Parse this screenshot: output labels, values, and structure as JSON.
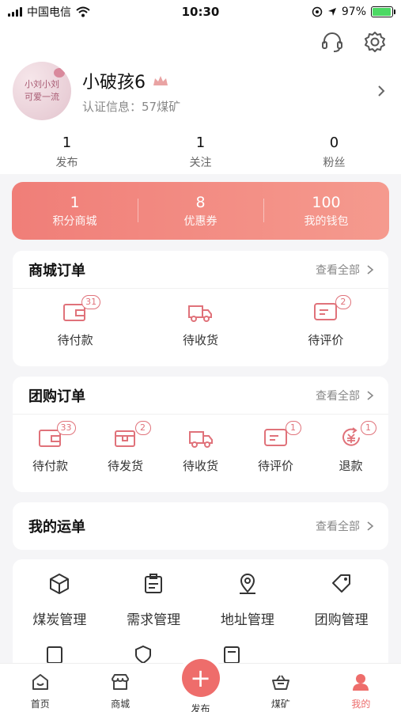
{
  "status_bar": {
    "carrier": "中国电信",
    "time": "10:30",
    "battery_percent": "97%",
    "battery_level": 0.97
  },
  "header": {
    "support_icon": "headset-icon",
    "settings_icon": "gear-icon"
  },
  "profile": {
    "name": "小破孩6",
    "cert_info": "认证信息：57煤矿",
    "avatar_text_line1": "小刘小刘",
    "avatar_text_line2": "可爱一流"
  },
  "stats": [
    {
      "value": "1",
      "label": "发布"
    },
    {
      "value": "1",
      "label": "关注"
    },
    {
      "value": "0",
      "label": "粉丝"
    }
  ],
  "wallet": [
    {
      "value": "1",
      "label": "积分商城"
    },
    {
      "value": "8",
      "label": "优惠券"
    },
    {
      "value": "100",
      "label": "我的钱包"
    }
  ],
  "mall_orders": {
    "title": "商城订单",
    "see_all": "查看全部",
    "items": [
      {
        "label": "待付款",
        "badge": "31",
        "icon": "wallet-icon"
      },
      {
        "label": "待收货",
        "badge": "",
        "icon": "truck-icon"
      },
      {
        "label": "待评价",
        "badge": "2",
        "icon": "comment-icon"
      }
    ]
  },
  "group_orders": {
    "title": "团购订单",
    "see_all": "查看全部",
    "items": [
      {
        "label": "待付款",
        "badge": "33",
        "icon": "wallet-icon"
      },
      {
        "label": "待发货",
        "badge": "2",
        "icon": "package-icon"
      },
      {
        "label": "待收货",
        "badge": "",
        "icon": "truck-icon"
      },
      {
        "label": "待评价",
        "badge": "1",
        "icon": "comment-icon"
      },
      {
        "label": "退款",
        "badge": "1",
        "icon": "refund-icon"
      }
    ]
  },
  "waybill": {
    "title": "我的运单",
    "see_all": "查看全部"
  },
  "tools": [
    {
      "label": "煤炭管理",
      "icon": "cube-icon"
    },
    {
      "label": "需求管理",
      "icon": "document-icon"
    },
    {
      "label": "地址管理",
      "icon": "location-icon"
    },
    {
      "label": "团购管理",
      "icon": "tag-icon"
    }
  ],
  "tabbar": [
    {
      "label": "首页",
      "icon": "home-icon"
    },
    {
      "label": "商城",
      "icon": "store-icon"
    },
    {
      "label": "发布",
      "icon": "plus-icon"
    },
    {
      "label": "煤矿",
      "icon": "basket-icon"
    },
    {
      "label": "我的",
      "icon": "user-icon"
    }
  ],
  "colors": {
    "accent": "#ee6d6b",
    "wallet_start": "#f07e78",
    "wallet_end": "#f59a8e"
  }
}
